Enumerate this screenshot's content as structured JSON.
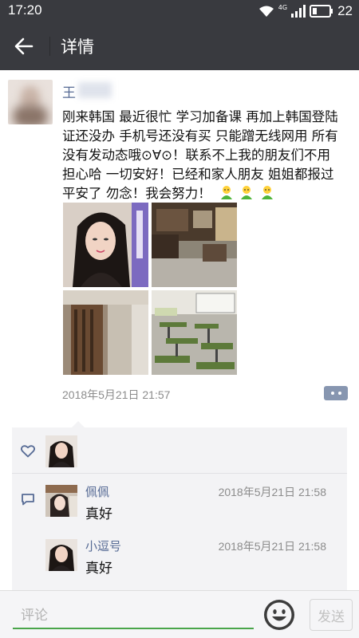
{
  "status_bar": {
    "time": "17:20",
    "network_label": "4G",
    "battery_percent": "22",
    "icons": [
      "wifi-icon",
      "signal-icon",
      "battery-icon"
    ]
  },
  "header": {
    "title": "详情",
    "back_icon": "arrow-left-icon"
  },
  "post": {
    "username": "王",
    "text": "刚来韩国 最近很忙 学习加备课 再加上韩国登陆证还没办 手机号还没有买 只能蹭无线网用 所有没有发动态哦⊙∀⊙！联系不上我的朋友们不用担心哈 一切安好！已经和家人朋友 姐姐都报过平安了 勿念！我会努力！",
    "emojis": [
      "person-emoji",
      "person-emoji",
      "person-emoji"
    ],
    "photos": [
      "selfie-photo",
      "classroom-reception-photo",
      "hallway-photo",
      "classroom-desks-photo"
    ],
    "time": "2018年5月21日 21:57"
  },
  "likes": {
    "icon": "heart-icon",
    "count": 1
  },
  "comments": [
    {
      "name": "佩佩",
      "time": "2018年5月21日 21:58",
      "text": "真好"
    },
    {
      "name": "小逗号",
      "time": "2018年5月21日 21:58",
      "text": "真好"
    }
  ],
  "input_bar": {
    "placeholder": "评论",
    "send_label": "发送"
  },
  "colors": {
    "bar": "#393a3f",
    "link": "#576b95",
    "accent": "#4aa54a",
    "panel": "#f3f3f5"
  }
}
